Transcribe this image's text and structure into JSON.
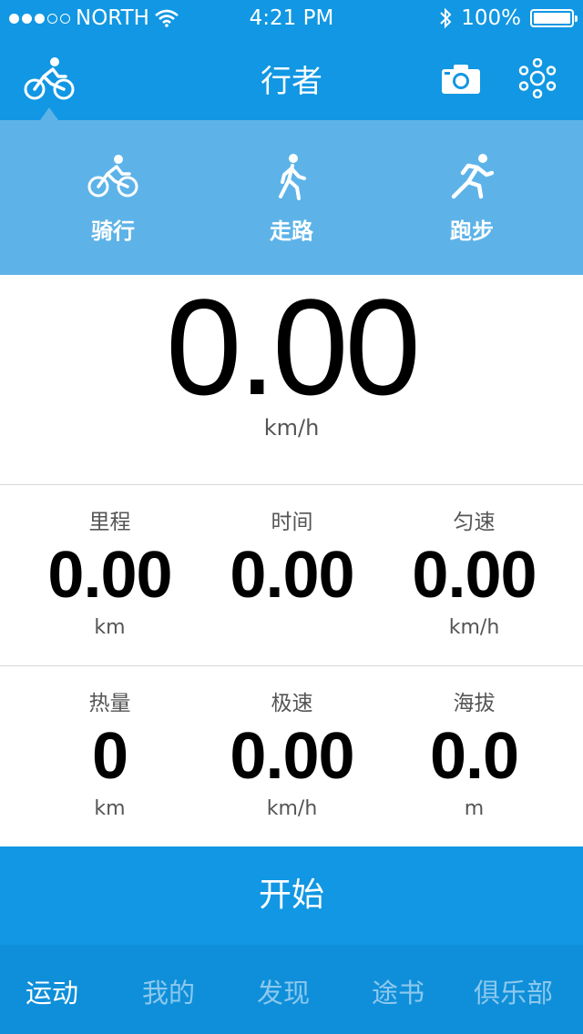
{
  "status_bar": {
    "carrier": "NORTH",
    "time": "4:21 PM",
    "battery": "100%"
  },
  "nav": {
    "title": "行者"
  },
  "modes": [
    {
      "label": "骑行",
      "icon": "bicycle-icon"
    },
    {
      "label": "走路",
      "icon": "walking-icon"
    },
    {
      "label": "跑步",
      "icon": "running-icon"
    }
  ],
  "speed": {
    "value": "0.00",
    "unit": "km/h"
  },
  "stats": {
    "row1": [
      {
        "name": "里程",
        "value": "0.00",
        "unit": "km"
      },
      {
        "name": "时间",
        "value": "0.00",
        "unit": ""
      },
      {
        "name": "匀速",
        "value": "0.00",
        "unit": "km/h"
      }
    ],
    "row2": [
      {
        "name": "热量",
        "value": "0",
        "unit": "km"
      },
      {
        "name": "极速",
        "value": "0.00",
        "unit": "km/h"
      },
      {
        "name": "海拔",
        "value": "0.0",
        "unit": "m"
      }
    ]
  },
  "start_button": {
    "label": "开始"
  },
  "tabs": [
    {
      "label": "运动",
      "active": true
    },
    {
      "label": "我的",
      "active": false
    },
    {
      "label": "发现",
      "active": false
    },
    {
      "label": "途书",
      "active": false
    },
    {
      "label": "俱乐部",
      "active": false
    }
  ],
  "colors": {
    "primary": "#1197e3",
    "mode_panel": "#5db3e8",
    "tab_inactive": "#8cc8ee"
  }
}
